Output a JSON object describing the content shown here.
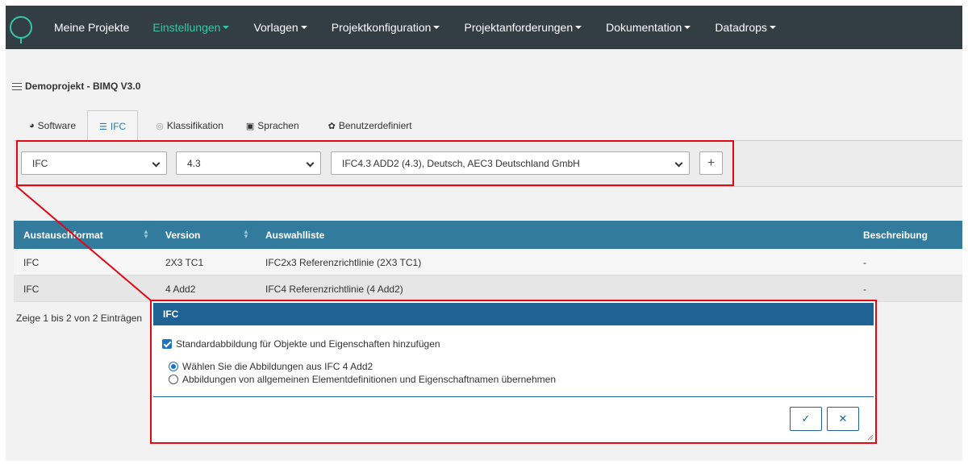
{
  "nav": {
    "items": [
      {
        "label": "Meine Projekte",
        "dropdown": false,
        "active": false
      },
      {
        "label": "Einstellungen",
        "dropdown": true,
        "active": true
      },
      {
        "label": "Vorlagen",
        "dropdown": true,
        "active": false
      },
      {
        "label": "Projektkonfiguration",
        "dropdown": true,
        "active": false
      },
      {
        "label": "Projektanforderungen",
        "dropdown": true,
        "active": false
      },
      {
        "label": "Dokumentation",
        "dropdown": true,
        "active": false
      },
      {
        "label": "Datadrops",
        "dropdown": true,
        "active": false
      }
    ]
  },
  "project": {
    "title": "Demoprojekt - BIMQ V3.0"
  },
  "tabs": [
    {
      "label": "Software",
      "icon": "software-icon",
      "active": false
    },
    {
      "label": "IFC",
      "icon": "ifc-stack-icon",
      "active": true
    },
    {
      "label": "Klassifikation",
      "icon": "classification-icon",
      "active": false
    },
    {
      "label": "Sprachen",
      "icon": "language-icon",
      "active": false
    },
    {
      "label": "Benutzerdefiniert",
      "icon": "custom-icon",
      "active": false
    }
  ],
  "filters": {
    "format": "IFC",
    "version": "4.3",
    "list": "IFC4.3 ADD2 (4.3), Deutsch, AEC3 Deutschland GmbH",
    "add_label": "+"
  },
  "table": {
    "columns": [
      "Austauschformat",
      "Version",
      "Auswahlliste",
      "Beschreibung"
    ],
    "rows": [
      [
        "IFC",
        "2X3 TC1",
        "IFC2x3 Referenzrichtlinie (2X3 TC1)",
        "-"
      ],
      [
        "IFC",
        "4 Add2",
        "IFC4 Referenzrichtlinie (4 Add2)",
        "-"
      ]
    ],
    "info": "Zeige 1 bis 2 von 2 Einträgen"
  },
  "modal": {
    "title": "IFC",
    "checkbox_label": "Standardabbildung für Objekte und Eigenschaften hinzufügen",
    "checkbox_checked": true,
    "options": [
      {
        "label": "Wählen Sie die Abbildungen aus IFC 4 Add2",
        "selected": true
      },
      {
        "label": "Abbildungen von allgemeinen Elementdefinitionen und Eigenschaftnamen übernehmen",
        "selected": false
      }
    ],
    "confirm_label": "✓",
    "cancel_label": "✕"
  },
  "colors": {
    "navbar": "#333d44",
    "accent": "#35c7a9",
    "table_header": "#337b9c",
    "modal_header": "#1f6293",
    "annotation": "#e30613"
  }
}
